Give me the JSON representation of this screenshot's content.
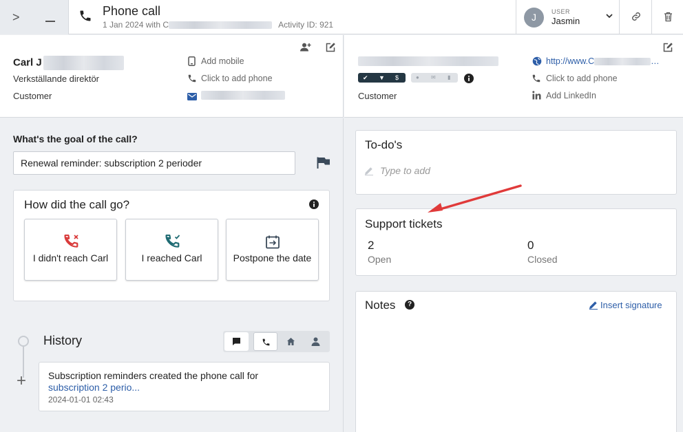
{
  "topbar": {
    "title": "Phone call",
    "subtitle_prefix": "1 Jan 2024 with C",
    "activity": "Activity ID: 921",
    "user_label": "USER",
    "user_name": "Jasmin",
    "avatar_initial": "J"
  },
  "contact_person": {
    "name": "Carl J",
    "title": "Verkställande direktör",
    "type": "Customer",
    "add_mobile": "Add mobile",
    "add_phone": "Click to add phone"
  },
  "company": {
    "type": "Customer",
    "website": "http://www.C",
    "website_suffix": "…",
    "add_phone": "Click to add phone",
    "add_linkedin": "Add LinkedIn",
    "badge_symbols": [
      "✔",
      "▼",
      "$"
    ]
  },
  "goal": {
    "label": "What's the goal of the call?",
    "value": "Renewal reminder: subscription 2 perioder"
  },
  "call_outcome": {
    "title": "How did the call go?",
    "options": [
      "I didn't reach Carl",
      "I reached Carl",
      "Postpone the date"
    ]
  },
  "history": {
    "title": "History",
    "entry_text": "Subscription reminders created the phone call for",
    "entry_link": "subscription 2 perio...",
    "entry_time": "2024-01-01 02:43"
  },
  "todos": {
    "title": "To-do's",
    "placeholder": "Type to add"
  },
  "support_tickets": {
    "title": "Support tickets",
    "open_count": "2",
    "open_label": "Open",
    "closed_count": "0",
    "closed_label": "Closed"
  },
  "notes": {
    "title": "Notes",
    "help": "?",
    "insert_signature": "Insert signature"
  },
  "colors": {
    "accent_blue": "#2d5ea8",
    "badge_dark": "#243743",
    "annotation_red": "#e03a3a",
    "missed_red": "#d93b3b",
    "reached_teal": "#1f6b73"
  }
}
